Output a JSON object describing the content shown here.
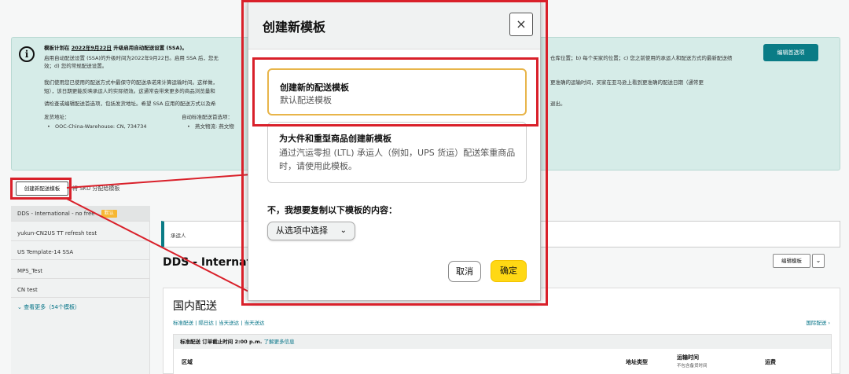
{
  "banner": {
    "line1_prefix": "模板计划在",
    "line1_date": "2022年9月22日",
    "line1_suffix": "升级启用自动配送设置 (SSA)。",
    "line2": "启用自动配送设置 (SSA)的升级时间为2022年9月22日。启用 SSA 后，您无",
    "line3": "效；d) 您的常规配送设置。",
    "line4": "我们使用您已使用的配送方式中最保守的配送承诺来计算运输时间。这样做，",
    "line5": "短），该日期更能反映承运人的实际绩效。这通常会带来更多的商品浏览量和",
    "line6": "请检查或编辑配送首选项，包括发货地址。希望 SSA 应用的配送方式以及希",
    "ship_from_label": "发货地址：",
    "ship_from_value": "OOC-China-Warehouse: CN, 734734",
    "auto_pref_label": "自动标准配送首选项：",
    "auto_pref_value": "燕文物流: 燕文物",
    "right_line1": "仓库位置；b) 每个买家的位置；c) 您之前使用的承运人和配送方式的最新配送绩",
    "right_line2": "更准确的运输时间，买家在亚马逊上看到更准确的配送日期（通常更",
    "right_line3": "退出。",
    "edit_pref_button": "编辑首选项"
  },
  "toolbar": {
    "create_button": "创建新配送模板",
    "sku_link": "将 SKU 分配给模板"
  },
  "sidebar": {
    "items": [
      {
        "label": "DDS - International - no free",
        "badge": "默认"
      },
      {
        "label": "yukun-CN2US TT refresh test"
      },
      {
        "label": "US Template-14 SSA"
      },
      {
        "label": "MPS_Test"
      },
      {
        "label": "CN test"
      }
    ],
    "see_more": "⌄ 查看更多（54个模板）"
  },
  "main": {
    "notice": "承运人",
    "title": "DDS - Internatio",
    "edit_template": "编辑模板",
    "domestic_title": "国内配送",
    "domestic_links": "标准配送 | 隔日达 | 当天送达 | 当天送达",
    "intl_link": "国际配送 ›",
    "std_head_text": "标准配送 订单截止时间 2:00 p.m.",
    "std_head_link": "了解更多信息",
    "col_region": "区域",
    "col_address_type": "地址类型",
    "col_transit": "运输时间",
    "col_transit_sub": "不包含备货时间",
    "col_fee": "运费"
  },
  "modal": {
    "title": "创建新模板",
    "close": "×",
    "option1_title": "创建新的配送模板",
    "option1_sub": "默认配送模板",
    "option2_title": "为大件和重型商品创建新模板",
    "option2_desc": "通过汽运零担 (LTL) 承运人（例如，UPS 货运）配送笨重商品时，请使用此模板。",
    "copy_label": "不，我想要复制以下模板的内容：",
    "select_placeholder": "从选项中选择",
    "cancel": "取消",
    "confirm": "确定"
  },
  "colors": {
    "accent_teal": "#0a7c86",
    "banner_bg": "#d6ece8",
    "confirm_yellow": "#ffd814",
    "highlight_red": "#d9202a",
    "option_border": "#e8b54a"
  }
}
